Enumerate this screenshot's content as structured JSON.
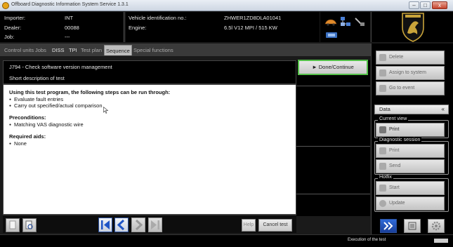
{
  "window": {
    "title": "Offboard Diagnostic Information System Service 1.3.1",
    "minimize": "–",
    "maximize": "□",
    "close": "x"
  },
  "header": {
    "importer_label": "Importer:",
    "importer_value": "INT",
    "dealer_label": "Dealer:",
    "dealer_value": "00088",
    "job_label": "Job:",
    "job_value": "---",
    "vin_label": "Vehicle identification no.:",
    "vin_value": "ZHWER1ZD8DLA01041",
    "engine_label": "Engine:",
    "engine_value": "6.5l V12 MPI / 515 KW"
  },
  "tabs": [
    "Control units",
    "Jobs",
    "DISS",
    "TPI",
    "Test plan",
    "Sequence",
    "Special functions"
  ],
  "active_tab": "Sequence",
  "test": {
    "title": "J794 - Check software version management",
    "subtitle": "Short description of test"
  },
  "done_button": "► Done/Continue",
  "content": {
    "intro_heading": "Using this test program, the following steps can be run through:",
    "steps": [
      "Evaluate fault entries",
      "Carry out specified/actual comparison"
    ],
    "preconditions_heading": "Preconditions:",
    "preconditions": [
      "Matching VAS diagnostic wire"
    ],
    "aids_heading": "Required aids:",
    "aids": [
      "None"
    ]
  },
  "bottom": {
    "help": "Help",
    "cancel": "Cancel test"
  },
  "sidebar": {
    "top_buttons": [
      "Delete",
      "Assign to system",
      "Go to event"
    ],
    "data_heading": "Data",
    "data_chevron": "«",
    "current_view_label": "Current view",
    "print": "Print",
    "diag_session_label": "Diagnostic session",
    "diag_buttons": [
      "Print",
      "Send"
    ],
    "hotfix_label": "Hotfix",
    "hotfix_buttons": [
      "Start",
      "Update"
    ]
  },
  "status": {
    "text": "Execution of the test"
  },
  "colors": {
    "done_border": "#55c04a",
    "nav_border": "#2a4f9c",
    "nav_arrow": "#1f55c6"
  }
}
